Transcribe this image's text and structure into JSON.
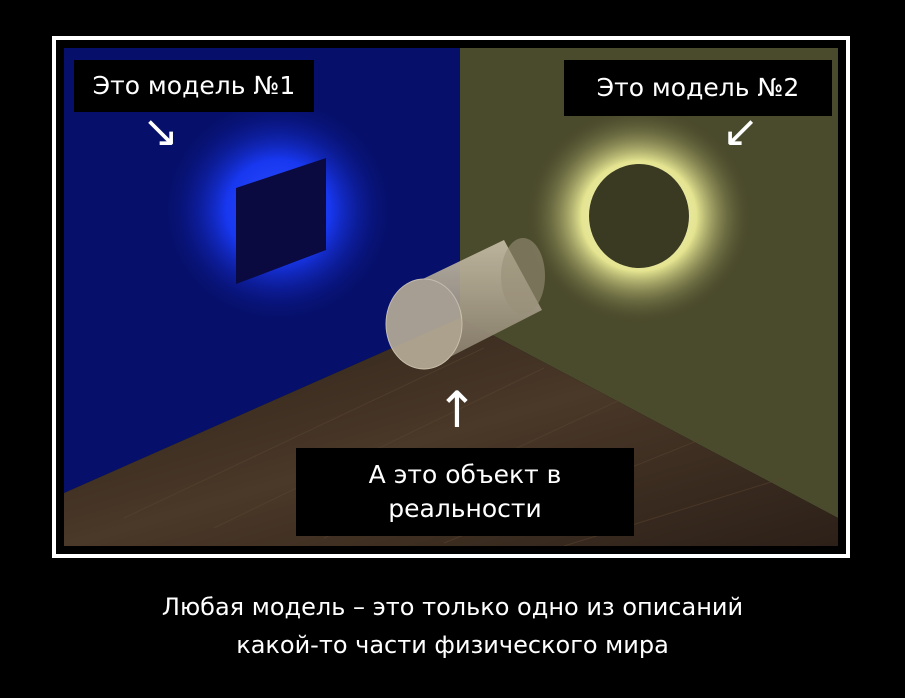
{
  "labels": {
    "model1": "Это модель №1",
    "model2": "Это модель №2",
    "object": "А это объект в реальности"
  },
  "icons": {
    "model1_arrow": "arrow-down-right-icon",
    "model2_arrow": "arrow-down-left-icon",
    "object_arrow": "arrow-up-icon"
  },
  "caption": {
    "line1": "Любая модель – это только одно из описаний",
    "line2": "какой-то части физического мира"
  },
  "colors": {
    "left_wall": "#06106a",
    "right_wall": "#4a4a2c",
    "blue_glow": "#1a3cff",
    "yellow_glow": "#f0f0a0",
    "floor": "#3a2c22",
    "border": "#ffffff",
    "background": "#000000"
  }
}
